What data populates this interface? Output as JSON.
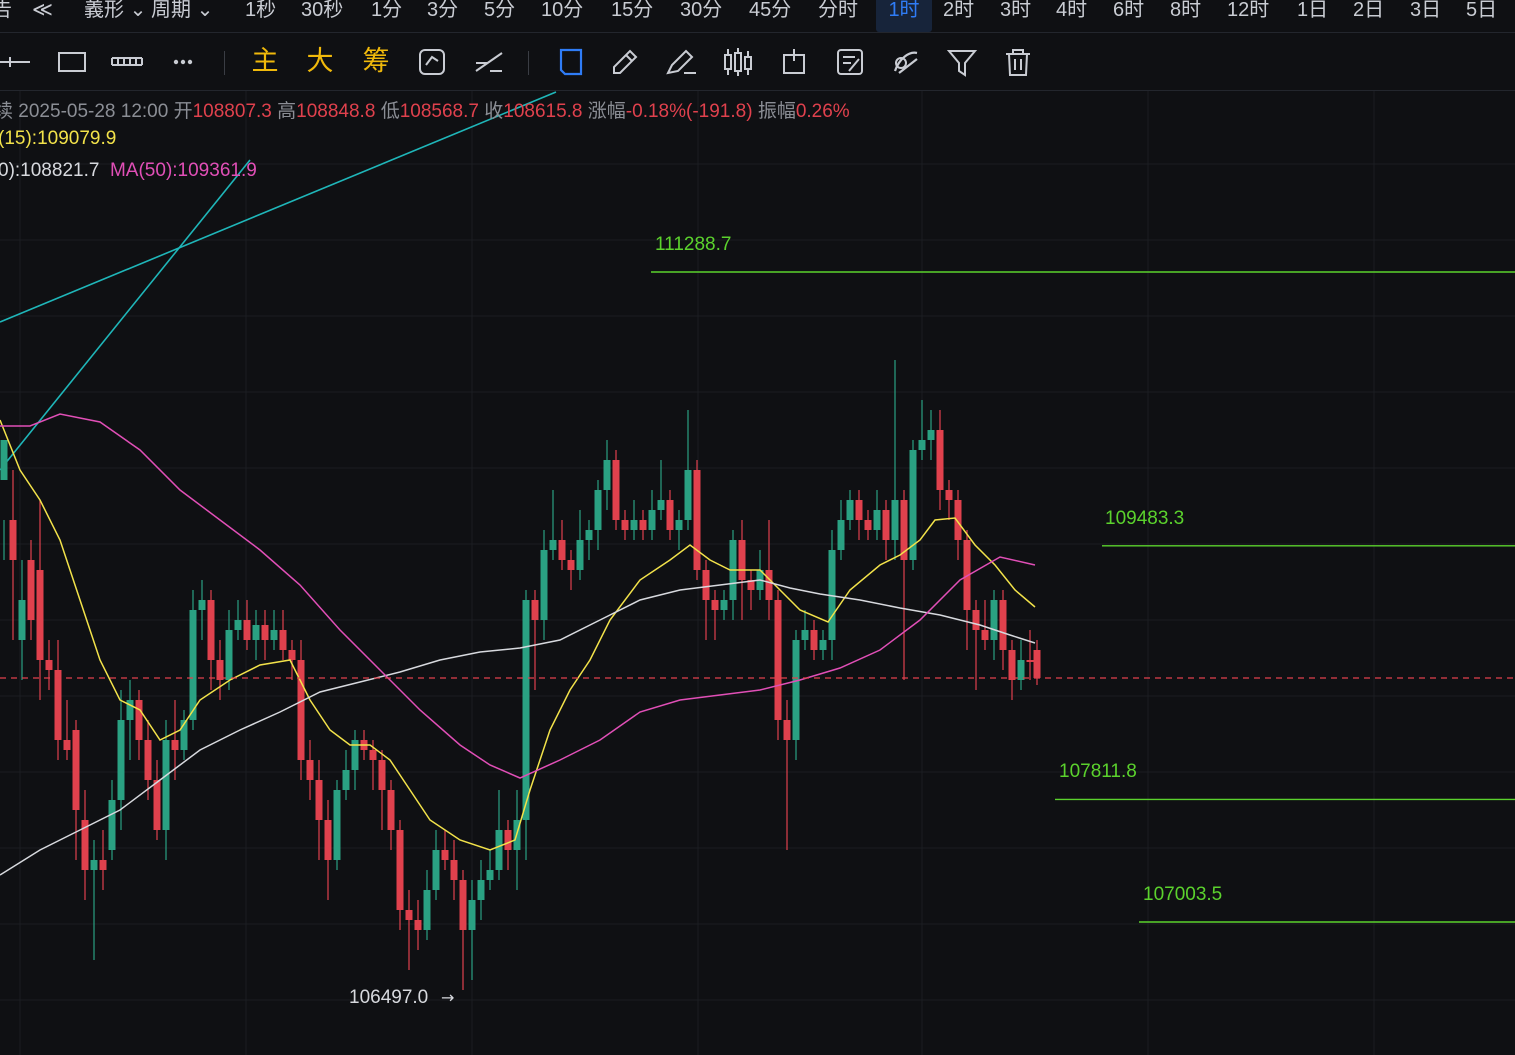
{
  "topbar": {
    "items": [
      "告",
      "≪",
      "義形",
      "周期",
      "1秒",
      "30秒",
      "1分",
      "3分",
      "5分",
      "10分",
      "15分",
      "30分",
      "45分",
      "分时",
      "1时",
      "2时",
      "3时",
      "4时",
      "6时",
      "8时",
      "12时",
      "1日",
      "2日",
      "3日",
      "5日"
    ],
    "active": "1时"
  },
  "toolbar": {
    "icons": [
      "crosshair-line-icon",
      "rectangle-icon",
      "ruler-icon",
      "more-dots-icon",
      "text-main-icon",
      "text-large-icon",
      "text-chip-icon",
      "replay-icon",
      "measure-icon",
      "bookmark-icon",
      "pencil-icon",
      "brush-icon",
      "candle-type-icon",
      "indicator-icon",
      "note-icon",
      "hide-drawings-icon",
      "filter-icon",
      "trash-icon"
    ],
    "text_main": "主",
    "text_large": "大",
    "text_chip": "筹"
  },
  "ohlc": {
    "prefix": "续",
    "date": "2025-05-28 12:00",
    "open_label": "开",
    "open": "108807.3",
    "high_label": "高",
    "high": "108848.8",
    "low_label": "低",
    "low": "108568.7",
    "close_label": "收",
    "close": "108615.8",
    "change_label": "涨幅",
    "change": "-0.18%(-191.8)",
    "amp_label": "振幅",
    "amp": "0.26%"
  },
  "ma": {
    "ma15": "(15):109079.9",
    "ma20": "0):108821.7",
    "ma50": "MA(50):109361.9"
  },
  "levels": {
    "l1": "111288.7",
    "l2": "109483.3",
    "l3": "107811.8",
    "l4": "107003.5",
    "low_marker": "106497.0"
  },
  "colors": {
    "up": "#2aa182",
    "down": "#e0414d",
    "ma15": "#f2e24a",
    "ma20": "#d7d9de",
    "ma50": "#e14fb7",
    "level": "#5bd22d",
    "trend": "#1fb6b9",
    "accent": "#2f7cf6"
  }
}
